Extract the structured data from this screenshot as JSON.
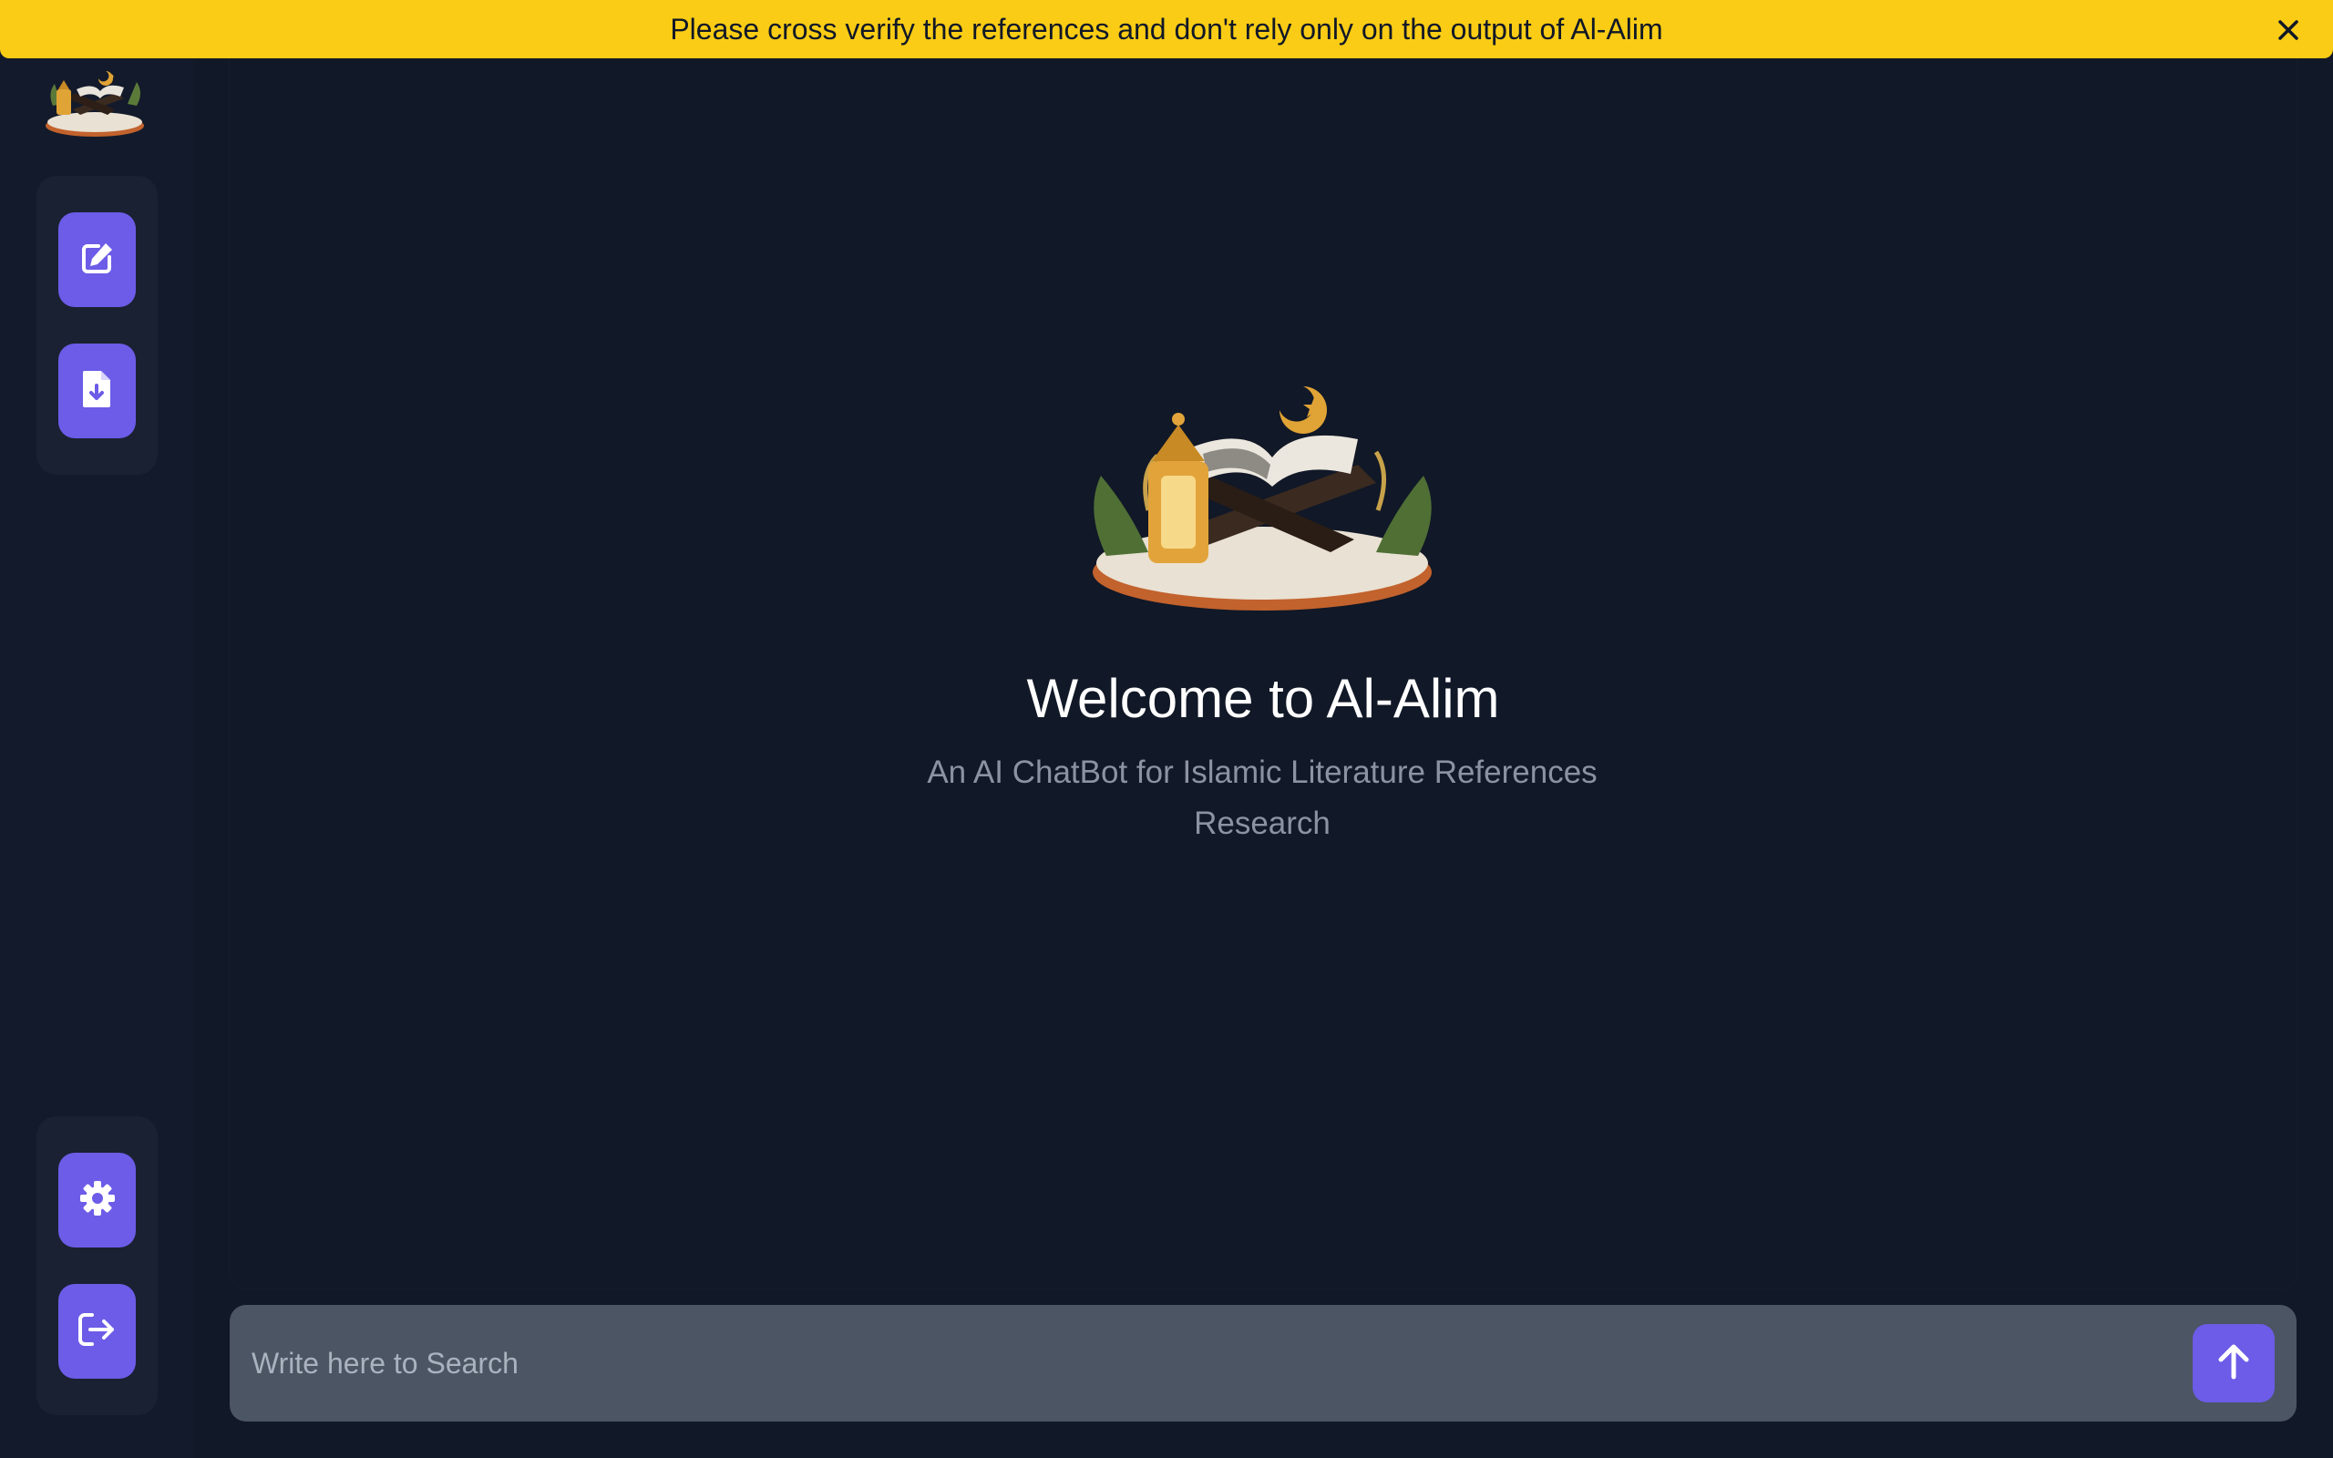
{
  "banner": {
    "message": "Please cross verify the references and don't rely only on the output of Al-Alim",
    "close_icon": "close-icon",
    "color": "#facc15"
  },
  "sidebar": {
    "logo": "quran-rehal-logo",
    "top_buttons": [
      {
        "icon": "edit-icon"
      },
      {
        "icon": "file-download-icon"
      }
    ],
    "bottom_buttons": [
      {
        "icon": "gear-icon"
      },
      {
        "icon": "logout-icon"
      }
    ],
    "accent": "#6c5ce7"
  },
  "main": {
    "hero_image": "quran-rehal-illustration",
    "title": "Welcome to Al-Alim",
    "subtitle": "An AI ChatBot for Islamic Literature References Research"
  },
  "search": {
    "placeholder": "Write here to Search",
    "value": "",
    "send_icon": "arrow-up-icon"
  }
}
